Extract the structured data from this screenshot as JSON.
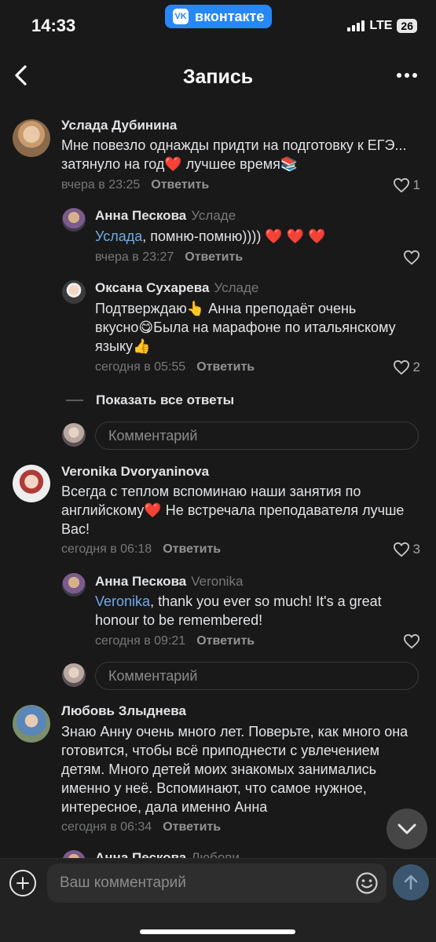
{
  "status_bar": {
    "time": "14:33",
    "app_badge": "вконтакте",
    "network": "LTE",
    "battery": "26"
  },
  "header": {
    "title": "Запись"
  },
  "comments": [
    {
      "author": "Услада Дубинина",
      "text": "Мне повезло однажды придти на подготовку к ЕГЭ... затянуло на год❤️ лучшее время📚",
      "time": "вчера в 23:25",
      "reply_label": "Ответить",
      "likes": "1",
      "replies": [
        {
          "author": "Анна Пескова",
          "reply_to": "Усладе",
          "mention": "Услада",
          "text": ", помню-помню)))) ❤️ ❤️ ❤️",
          "time": "вчера в 23:27",
          "reply_label": "Ответить",
          "likes": ""
        },
        {
          "author": "Оксана Сухарева",
          "reply_to": "Усладе",
          "text": "Подтверждаю👆 Анна преподаёт очень вкусно😋Была на марафоне по итальянскому языку👍",
          "time": "сегодня в 05:55",
          "reply_label": "Ответить",
          "likes": "2"
        }
      ],
      "show_all": "Показать все ответы",
      "comment_placeholder": "Комментарий"
    },
    {
      "author": "Veronika Dvoryaninova",
      "text": "Всегда с теплом вспоминаю наши занятия по английскому❤️ Не встречала преподавателя лучше Вас!",
      "time": "сегодня в 06:18",
      "reply_label": "Ответить",
      "likes": "3",
      "replies": [
        {
          "author": "Анна Пескова",
          "reply_to": "Veronika",
          "mention": "Veronika",
          "text": ", thank you ever so much! It's a great honour to be remembered!",
          "time": "сегодня в 09:21",
          "reply_label": "Ответить",
          "likes": ""
        }
      ],
      "comment_placeholder": "Комментарий"
    },
    {
      "author": "Любовь Злыднева",
      "text": "Знаю Анну очень много лет. Поверьте, как много она готовится, чтобы всё приподнести с увлечением детям. Много детей моих знакомых занимались именно у неё. Вспоминают, что самое нужное,  интересное, дала именно Анна",
      "time": "сегодня в 06:34",
      "reply_label": "Ответить",
      "replies": [
        {
          "author": "Анна Пескова",
          "reply_to": "Любови"
        }
      ]
    }
  ],
  "composer": {
    "placeholder": "Ваш комментарий"
  },
  "colors": {
    "background": "#191919",
    "accent_link": "#71aaeb",
    "vk_blue": "#2787f5",
    "heart_red": "#e0271a"
  },
  "icons": [
    "back-icon",
    "more-icon",
    "heart-icon",
    "chevron-down-icon",
    "plus-icon",
    "emoji-icon",
    "send-arrow-icon",
    "vk-logo-icon"
  ]
}
